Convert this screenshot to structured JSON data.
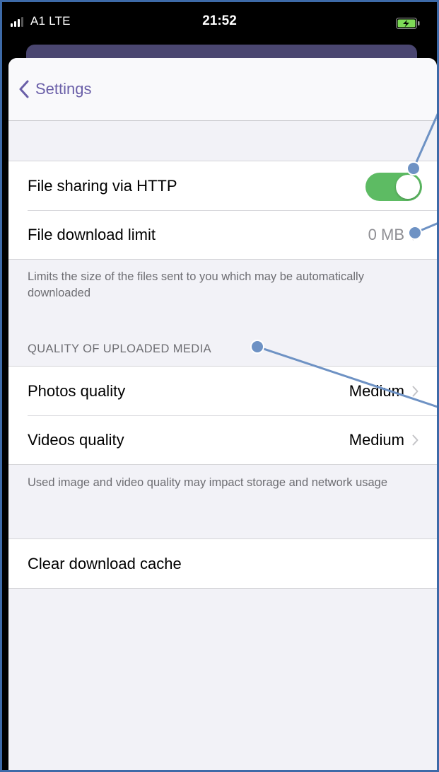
{
  "status_bar": {
    "carrier": "A1  LTE",
    "time": "21:52",
    "signal_icon": "signal-icon",
    "battery_icon": "battery-charging-icon",
    "battery_color": "#7ed957"
  },
  "nav": {
    "back_label": "Settings",
    "back_icon": "chevron-left-icon",
    "accent_color": "#6a5fa8"
  },
  "sharing_group": {
    "http_sharing": {
      "label": "File sharing via HTTP",
      "enabled": true,
      "toggle_color": "#5dbb63"
    },
    "download_limit": {
      "label": "File download limit",
      "value": "0 MB"
    },
    "footer": "Limits the size of the files sent to you which may be automatically downloaded"
  },
  "media_quality": {
    "header": "QUALITY OF UPLOADED MEDIA",
    "photos": {
      "label": "Photos quality",
      "value": "Medium"
    },
    "videos": {
      "label": "Videos quality",
      "value": "Medium"
    },
    "footer": "Used image and video quality may impact storage and network usage"
  },
  "cache": {
    "clear_label": "Clear download cache"
  },
  "annotation_color": "#6e92c4"
}
